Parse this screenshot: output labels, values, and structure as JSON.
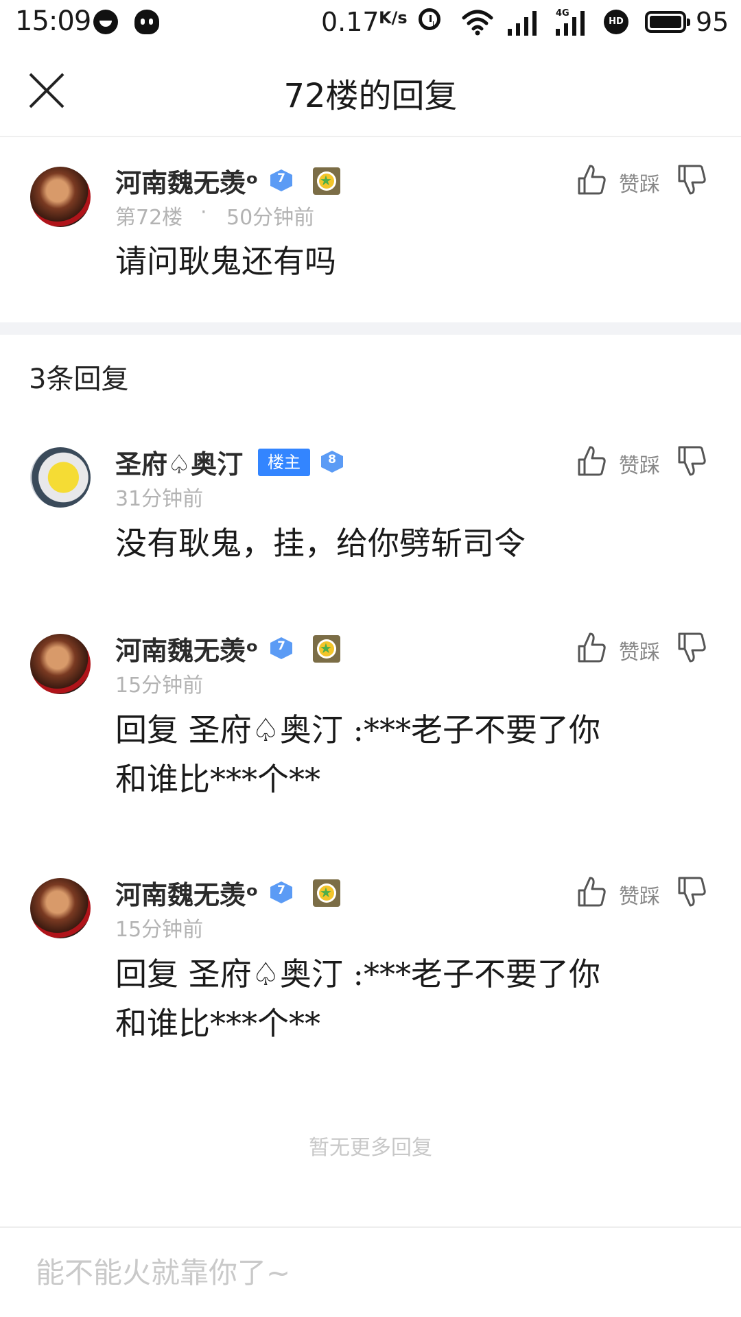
{
  "status_bar": {
    "time": "15:09",
    "net_speed": "0.17",
    "net_unit": "K/s",
    "lte_label": "4G",
    "hd_label": "HD",
    "battery": "95"
  },
  "header": {
    "title": "72楼的回复",
    "close_icon": "close-icon"
  },
  "floor_post": {
    "username": "河南魏无羡ᵒ",
    "level": "7",
    "floor": "第72楼",
    "dot": "·",
    "time": "50分钟前",
    "content": "请问耿鬼还有吗",
    "like_label": "赞踩"
  },
  "replies_header": "3条回复",
  "replies": [
    {
      "username": "圣府♤奥汀",
      "owner_badge": "楼主",
      "level": "8",
      "time": "31分钟前",
      "content": "没有耿鬼，挂，给你劈斩司令",
      "like_label": "赞踩"
    },
    {
      "username": "河南魏无羡ᵒ",
      "level": "7",
      "time": "15分钟前",
      "content": "回复 圣府♤奥汀 :***老子不要了你\n和谁比***个**",
      "like_label": "赞踩"
    },
    {
      "username": "河南魏无羡ᵒ",
      "level": "7",
      "time": "15分钟前",
      "content": "回复 圣府♤奥汀 :***老子不要了你\n和谁比***个**",
      "like_label": "赞踩"
    }
  ],
  "no_more": "暂无更多回复",
  "reply_input": {
    "placeholder": "能不能火就靠你了~"
  },
  "colors": {
    "accent": "#3385ff",
    "level_badge": "#5b9bf5",
    "muted_text": "#b3b3b3"
  }
}
